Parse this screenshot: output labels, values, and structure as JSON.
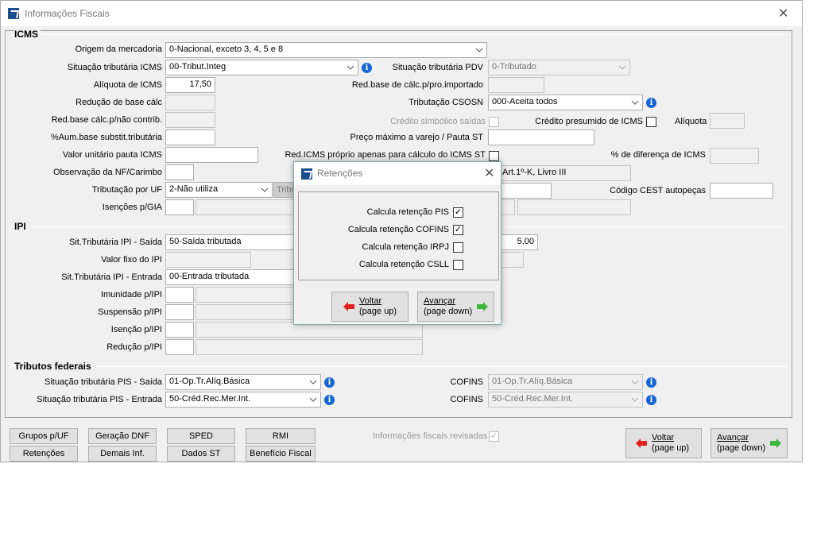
{
  "window": {
    "title": "Informações Fiscais",
    "close": "✕"
  },
  "icms": {
    "title": "ICMS",
    "origem": {
      "label": "Origem da mercadoria",
      "value": "0-Nacional, exceto 3, 4, 5 e 8"
    },
    "sit_trib": {
      "label": "Situação tributária ICMS",
      "value": "00-Tribut.Integ"
    },
    "aliquota": {
      "label": "Alíquota de ICMS",
      "value": "17,50"
    },
    "reducao": {
      "label": "Redução de base cálc",
      "value": ""
    },
    "red_nao_contrib": {
      "label": "Red.base cálc.p/não contrib.",
      "value": ""
    },
    "aum_base": {
      "label": "%Aum.base substit.tributária",
      "value": ""
    },
    "valor_pauta": {
      "label": "Valor unitário pauta ICMS",
      "value": ""
    },
    "observacao": {
      "label": "Observação da NF/Carimbo",
      "value": ""
    },
    "trib_uf": {
      "label": "Tributação por UF",
      "value": "2-Não utiliza",
      "extra": "Tribu"
    },
    "isencoes_gia": {
      "label": "Isenções p/GIA",
      "value": ""
    },
    "sit_pdv": {
      "label": "Situação tributária PDV",
      "value": "0-Tributado"
    },
    "red_importado": {
      "label": "Red.base de cálc.p/pro.importado",
      "value": ""
    },
    "csosn": {
      "label": "Tributação CSOSN",
      "value": "000-Aceita todos"
    },
    "credito_simbolico": {
      "label": "Crédito simbólico saídas",
      "checked": false
    },
    "credito_presumido": {
      "label": "Crédito presumido de ICMS",
      "checked": false
    },
    "aliquota_presumido": {
      "label": "Alíquota",
      "value": ""
    },
    "preco_maximo": {
      "label": "Preço máximo a varejo / Pauta ST",
      "value": ""
    },
    "red_icms_proprio": {
      "label": "Red.ICMS próprio apenas para cálculo do ICMS ST",
      "checked": false
    },
    "perc_diferenca": {
      "label": "% de diferença de ICMS",
      "value": ""
    },
    "artigo": {
      "value": "Art.1º-K, Livro III"
    },
    "cest": {
      "label": "Código CEST autopeças",
      "value": ""
    }
  },
  "ipi": {
    "title": "IPI",
    "sit_saida": {
      "label": "Sit.Tributária IPI - Saída",
      "value": "50-Saída tributada"
    },
    "aliquota": {
      "value": "5,00"
    },
    "valor_fixo": {
      "label": "Valor fixo do IPI",
      "value": ""
    },
    "sit_entrada": {
      "label": "Sit.Tributária IPI - Entrada",
      "value": "00-Entrada tributada"
    },
    "imunidade": {
      "label": "Imunidade p/IPI"
    },
    "suspensao": {
      "label": "Suspensão p/IPI"
    },
    "isencao": {
      "label": "Isenção p/IPI"
    },
    "reducao": {
      "label": "Redução p/IPI"
    }
  },
  "federais": {
    "title": "Tributos federais",
    "pis_saida": {
      "label": "Situação tributária PIS - Saída",
      "value": "01-Op.Tr.Alíq.Básica"
    },
    "pis_entrada": {
      "label": "Situação tributária PIS - Entrada",
      "value": "50-Créd.Rec.Mer.Int."
    },
    "cofins_saida": {
      "label": "COFINS",
      "value": "01-Op.Tr.Alíq.Básica"
    },
    "cofins_entrada": {
      "label": "COFINS",
      "value": "50-Créd.Rec.Mer.Int."
    }
  },
  "footer": {
    "buttons": [
      "Grupos p/UF",
      "Geração DNF",
      "SPED",
      "RMI",
      "Retenções",
      "Demais Inf.",
      "Dados ST",
      "Benefício Fiscal"
    ],
    "revisadas": {
      "label": "Informações fiscais revisadas",
      "checked": true
    },
    "voltar": {
      "line1": "Voltar",
      "line2": "(page up)"
    },
    "avancar": {
      "line1": "Avançar",
      "line2": "(page down)"
    }
  },
  "dialog": {
    "title": "Retenções",
    "close": "✕",
    "options": [
      {
        "label": "Calcula retenção PIS",
        "checked": true
      },
      {
        "label": "Calcula retenção COFINS",
        "checked": true
      },
      {
        "label": "Calcula retenção IRPJ",
        "checked": false
      },
      {
        "label": "Calcula retenção CSLL",
        "checked": false
      }
    ],
    "voltar": {
      "line1": "Voltar",
      "line2": "(page up)"
    },
    "avancar": {
      "line1": "Avançar",
      "line2": "(page down)"
    }
  },
  "colors": {
    "info": "#1565d8",
    "back_arrow": "#e02020",
    "next_arrow": "#3cb83c"
  }
}
